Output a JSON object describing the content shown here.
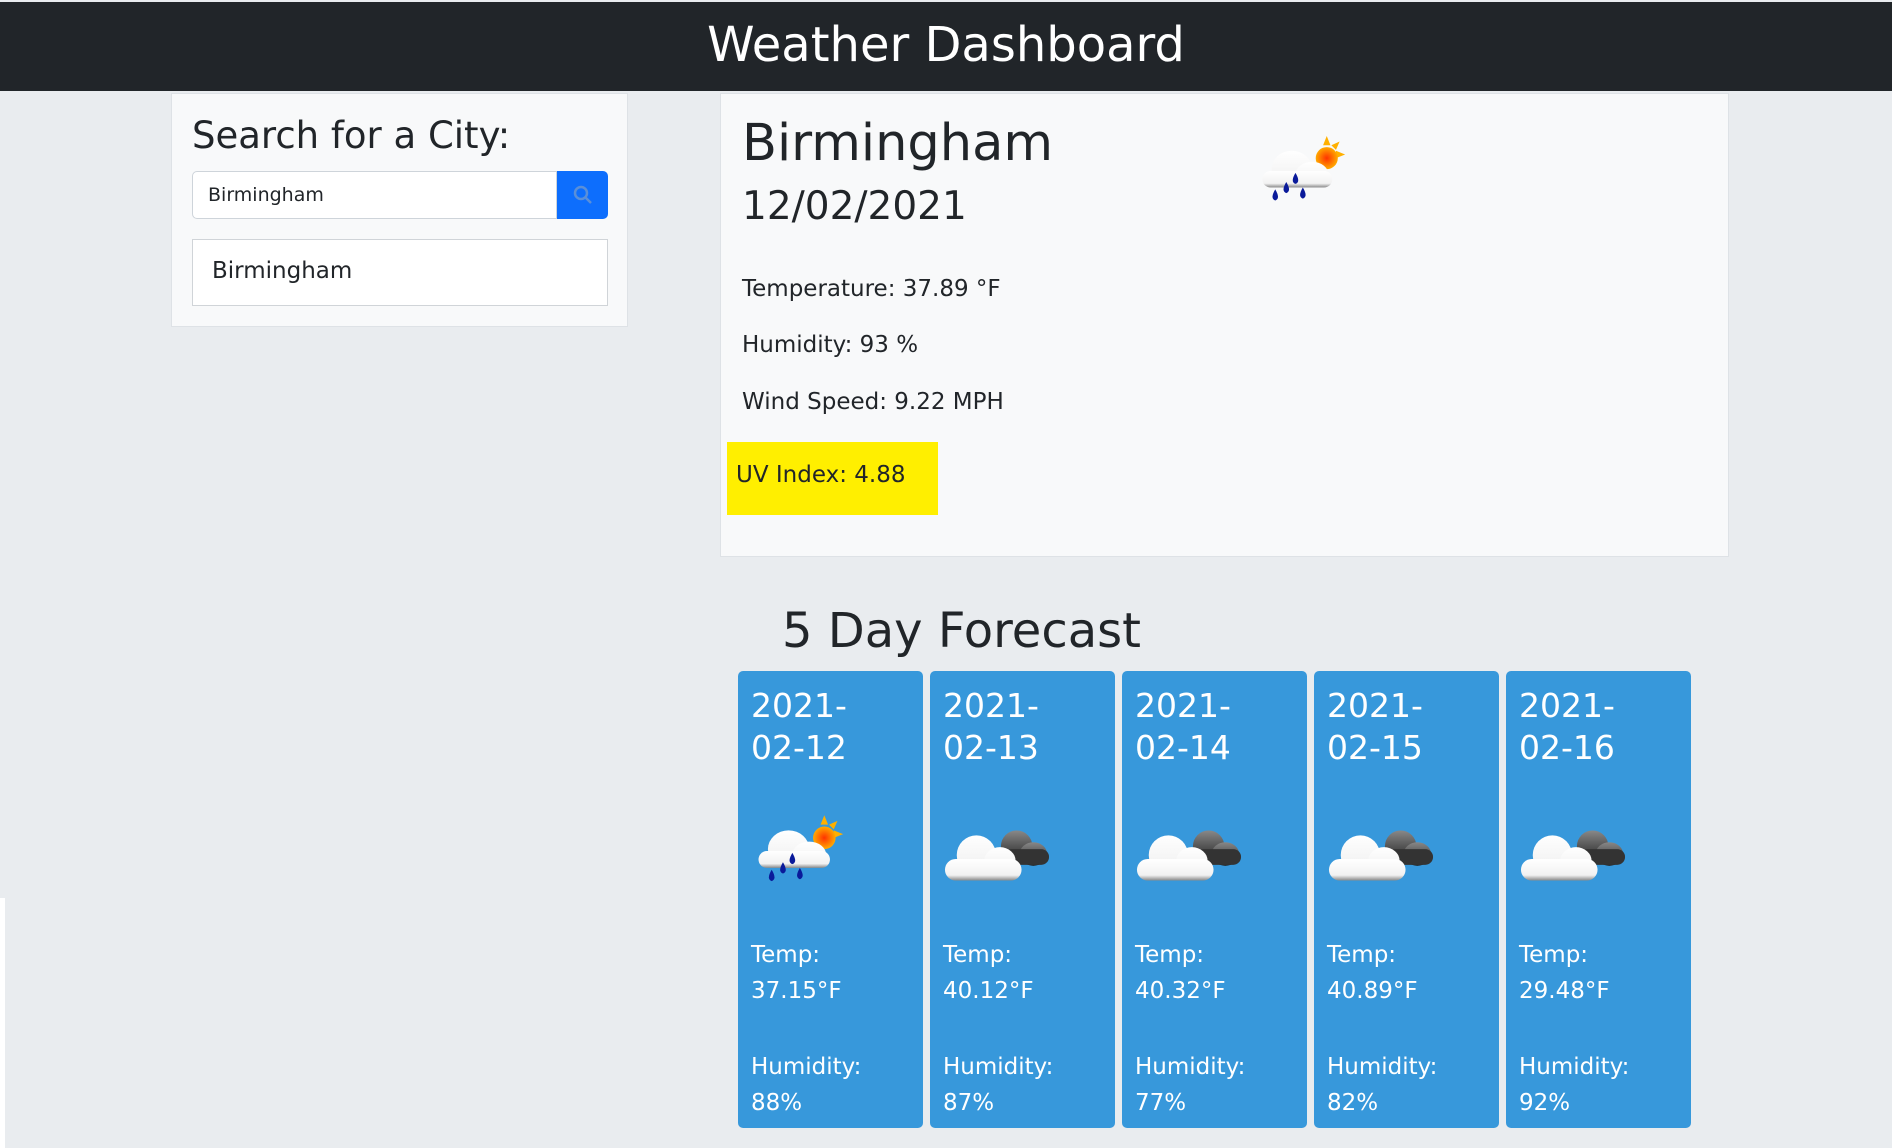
{
  "header": {
    "title": "Weather Dashboard"
  },
  "search": {
    "heading": "Search for a City:",
    "value": "Birmingham",
    "button_icon": "search-icon",
    "history": [
      "Birmingham"
    ]
  },
  "current": {
    "city": "Birmingham",
    "date": "12/02/2021",
    "icon": "rain-sun-icon",
    "temperature": "Temperature: 37.89 °F",
    "humidity": "Humidity: 93 %",
    "wind": "Wind Speed: 9.22 MPH",
    "uv": "UV Index: 4.88",
    "uv_color": "#ffef00"
  },
  "forecast": {
    "title": "5 Day Forecast",
    "card_color": "#3798db",
    "temp_label": "Temp:",
    "humidity_label": "Humidity:",
    "days": [
      {
        "date_line1": "2021-",
        "date_line2": "02-12",
        "icon": "rain-sun-icon",
        "temp": "37.15°F",
        "humidity": "88%"
      },
      {
        "date_line1": "2021-",
        "date_line2": "02-13",
        "icon": "cloudy-icon",
        "temp": "40.12°F",
        "humidity": "87%"
      },
      {
        "date_line1": "2021-",
        "date_line2": "02-14",
        "icon": "cloudy-icon",
        "temp": "40.32°F",
        "humidity": "77%"
      },
      {
        "date_line1": "2021-",
        "date_line2": "02-15",
        "icon": "cloudy-icon",
        "temp": "40.89°F",
        "humidity": "82%"
      },
      {
        "date_line1": "2021-",
        "date_line2": "02-16",
        "icon": "cloudy-icon",
        "temp": "29.48°F",
        "humidity": "92%"
      }
    ]
  }
}
